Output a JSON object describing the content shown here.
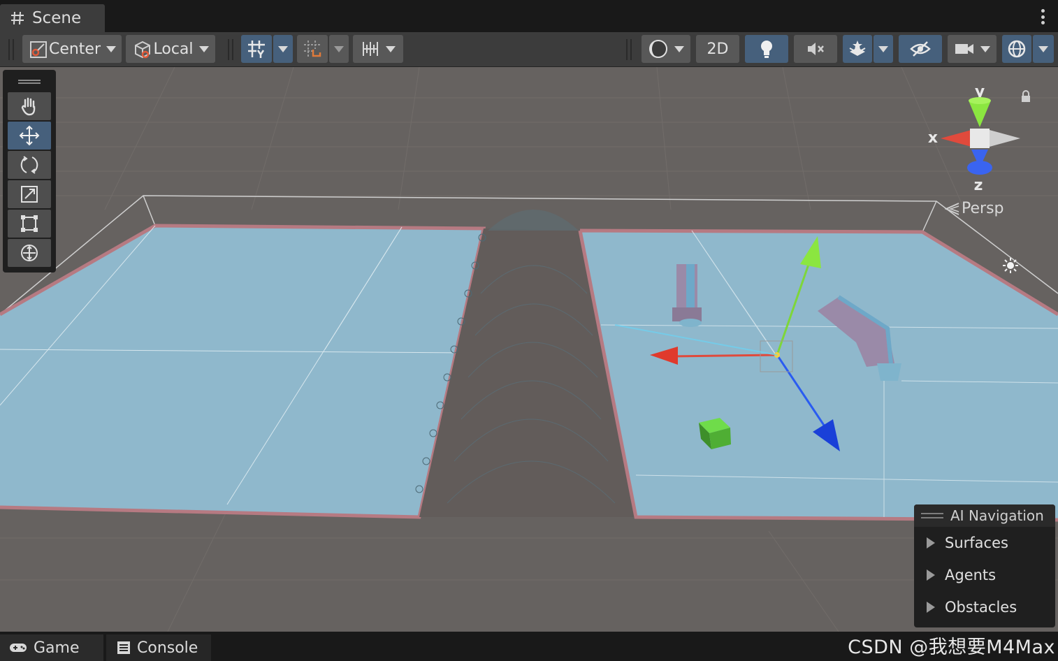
{
  "window": {
    "tab_title": "Scene",
    "tab_icon": "grid-hash-icon"
  },
  "toolbar": {
    "pivot_mode": "Center",
    "pivot_rotation": "Local",
    "mode_2d": "2D",
    "buttons": [
      "grid-snap-icon",
      "increment-snap-icon",
      "ruler-grid-icon",
      "shading-mode-icon",
      "lighting-icon",
      "audio-mute-icon",
      "effects-icon",
      "visibility-icon",
      "camera-icon",
      "gizmos-icon"
    ]
  },
  "tools": [
    "hand-tool",
    "move-tool",
    "rotate-tool",
    "scale-tool",
    "rect-tool",
    "transform-tool"
  ],
  "gizmo": {
    "y_label": "y",
    "x_label": "x",
    "z_label": "z",
    "projection": "Persp"
  },
  "ai_navigation": {
    "title": "AI Navigation",
    "items": [
      "Surfaces",
      "Agents",
      "Obstacles"
    ]
  },
  "bottom_tabs": {
    "game": "Game",
    "console": "Console"
  },
  "watermark": "CSDN @我想要M4Max",
  "colors": {
    "viewport_bg": "#666260",
    "navmesh": "#8fb8cc",
    "navmesh_edge": "#b67a82",
    "active_button": "#46607c",
    "axis_x": "#e04a3c",
    "axis_y": "#7ed63a",
    "axis_z": "#2a5cf0"
  }
}
